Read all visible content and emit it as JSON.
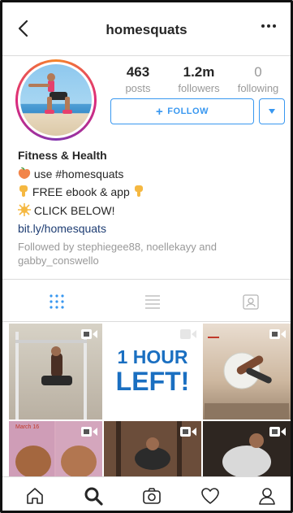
{
  "header": {
    "title": "homesquats"
  },
  "stats": {
    "posts_count": "463",
    "posts_label": "posts",
    "followers_count": "1.2m",
    "followers_label": "followers",
    "following_count": "0",
    "following_label": "following"
  },
  "actions": {
    "follow_label": "FOLLOW"
  },
  "bio": {
    "name": "Fitness & Health",
    "line1": "use #homesquats",
    "line2": "FREE ebook & app",
    "line3": "CLICK BELOW!",
    "link": "bit.ly/homesquats",
    "followed_by": "Followed by stephiegee88, noellekayy and gabby_conswello"
  },
  "grid": {
    "promo_line1": "1 HOUR",
    "promo_line2": "LEFT!",
    "date_label": "March 16"
  },
  "colors": {
    "accent": "#3897f0",
    "link": "#1e3d73",
    "muted": "#999999",
    "promo_text": "#1a6fc1"
  }
}
